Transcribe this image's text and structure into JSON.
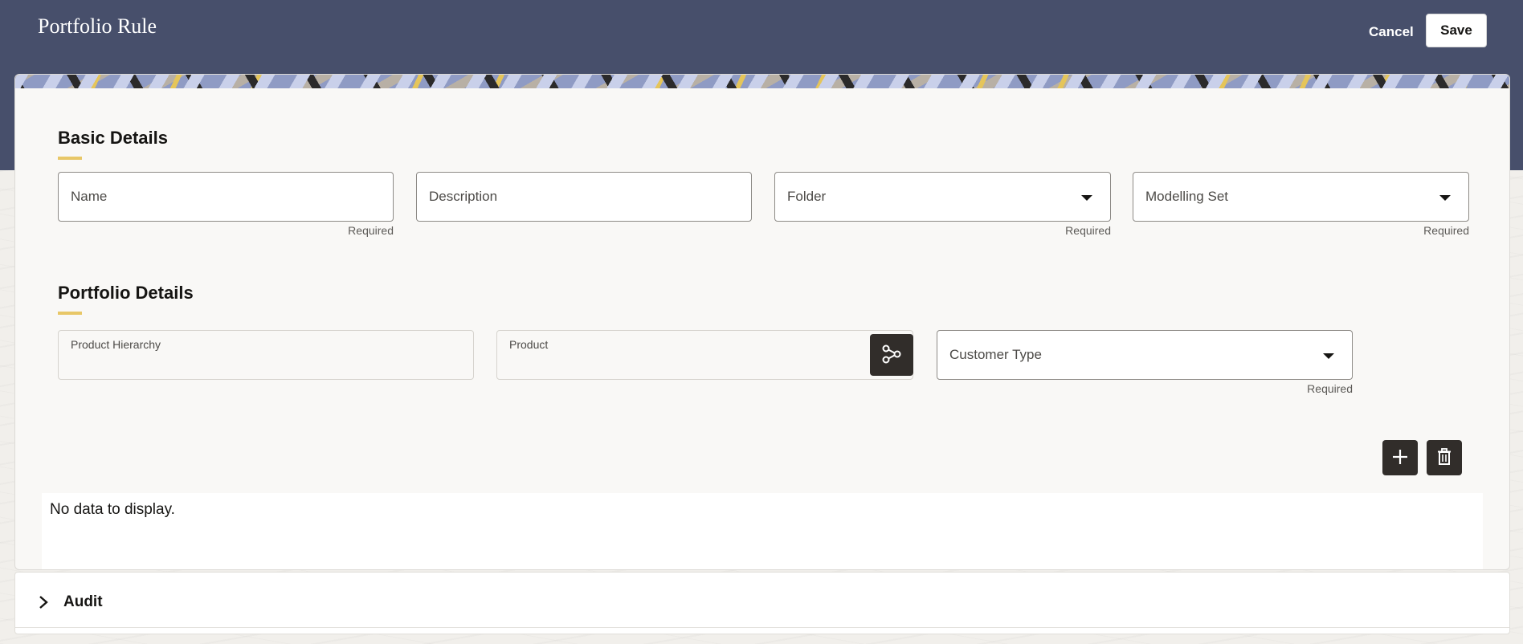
{
  "header": {
    "title": "Portfolio Rule",
    "cancel_label": "Cancel",
    "save_label": "Save"
  },
  "basic_details": {
    "title": "Basic Details",
    "fields": {
      "name": {
        "label": "Name",
        "helper": "Required"
      },
      "description": {
        "label": "Description"
      },
      "folder": {
        "label": "Folder",
        "helper": "Required"
      },
      "modelling_set": {
        "label": "Modelling Set",
        "helper": "Required"
      }
    }
  },
  "portfolio_details": {
    "title": "Portfolio Details",
    "fields": {
      "product_hierarchy": {
        "label": "Product Hierarchy"
      },
      "product": {
        "label": "Product"
      },
      "customer_type": {
        "label": "Customer Type",
        "helper": "Required"
      }
    }
  },
  "table": {
    "empty_text": "No data to display."
  },
  "audit": {
    "label": "Audit"
  },
  "colors": {
    "header_bg": "#474f6b",
    "accent_underline": "#e8c767",
    "icon_button_bg": "#312d2a"
  },
  "icons": {
    "hierarchy": "hierarchy-icon",
    "add": "plus-icon",
    "delete": "trash-icon",
    "expand": "chevron-right-icon",
    "dropdown": "caret-down-icon"
  }
}
